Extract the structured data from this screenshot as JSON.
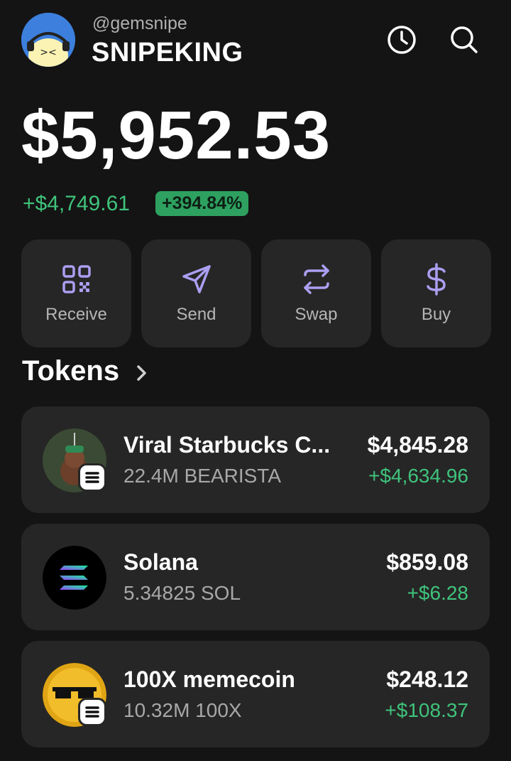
{
  "header": {
    "handle": "@gemsnipe",
    "username": "SNIPEKING",
    "history_icon": "clock-icon",
    "search_icon": "search-icon"
  },
  "balance": {
    "total": "$5,952.53",
    "change_abs": "+$4,749.61",
    "change_pct": "+394.84%"
  },
  "actions": [
    {
      "label": "Receive",
      "icon": "qr-code-icon"
    },
    {
      "label": "Send",
      "icon": "send-icon"
    },
    {
      "label": "Swap",
      "icon": "swap-icon"
    },
    {
      "label": "Buy",
      "icon": "dollar-icon"
    }
  ],
  "tokens_section": {
    "title": "Tokens"
  },
  "tokens": [
    {
      "name": "Viral Starbucks C...",
      "amount": "22.4M BEARISTA",
      "value": "$4,845.28",
      "change": "+$4,634.96"
    },
    {
      "name": "Solana",
      "amount": "5.34825 SOL",
      "value": "$859.08",
      "change": "+$6.28"
    },
    {
      "name": "100X memecoin",
      "amount": "10.32M 100X",
      "value": "$248.12",
      "change": "+$108.37"
    }
  ],
  "colors": {
    "background": "#141414",
    "card": "#262626",
    "accent": "#ab9ff2",
    "positive": "#3fc37b",
    "positive_badge": "#2ea160"
  }
}
